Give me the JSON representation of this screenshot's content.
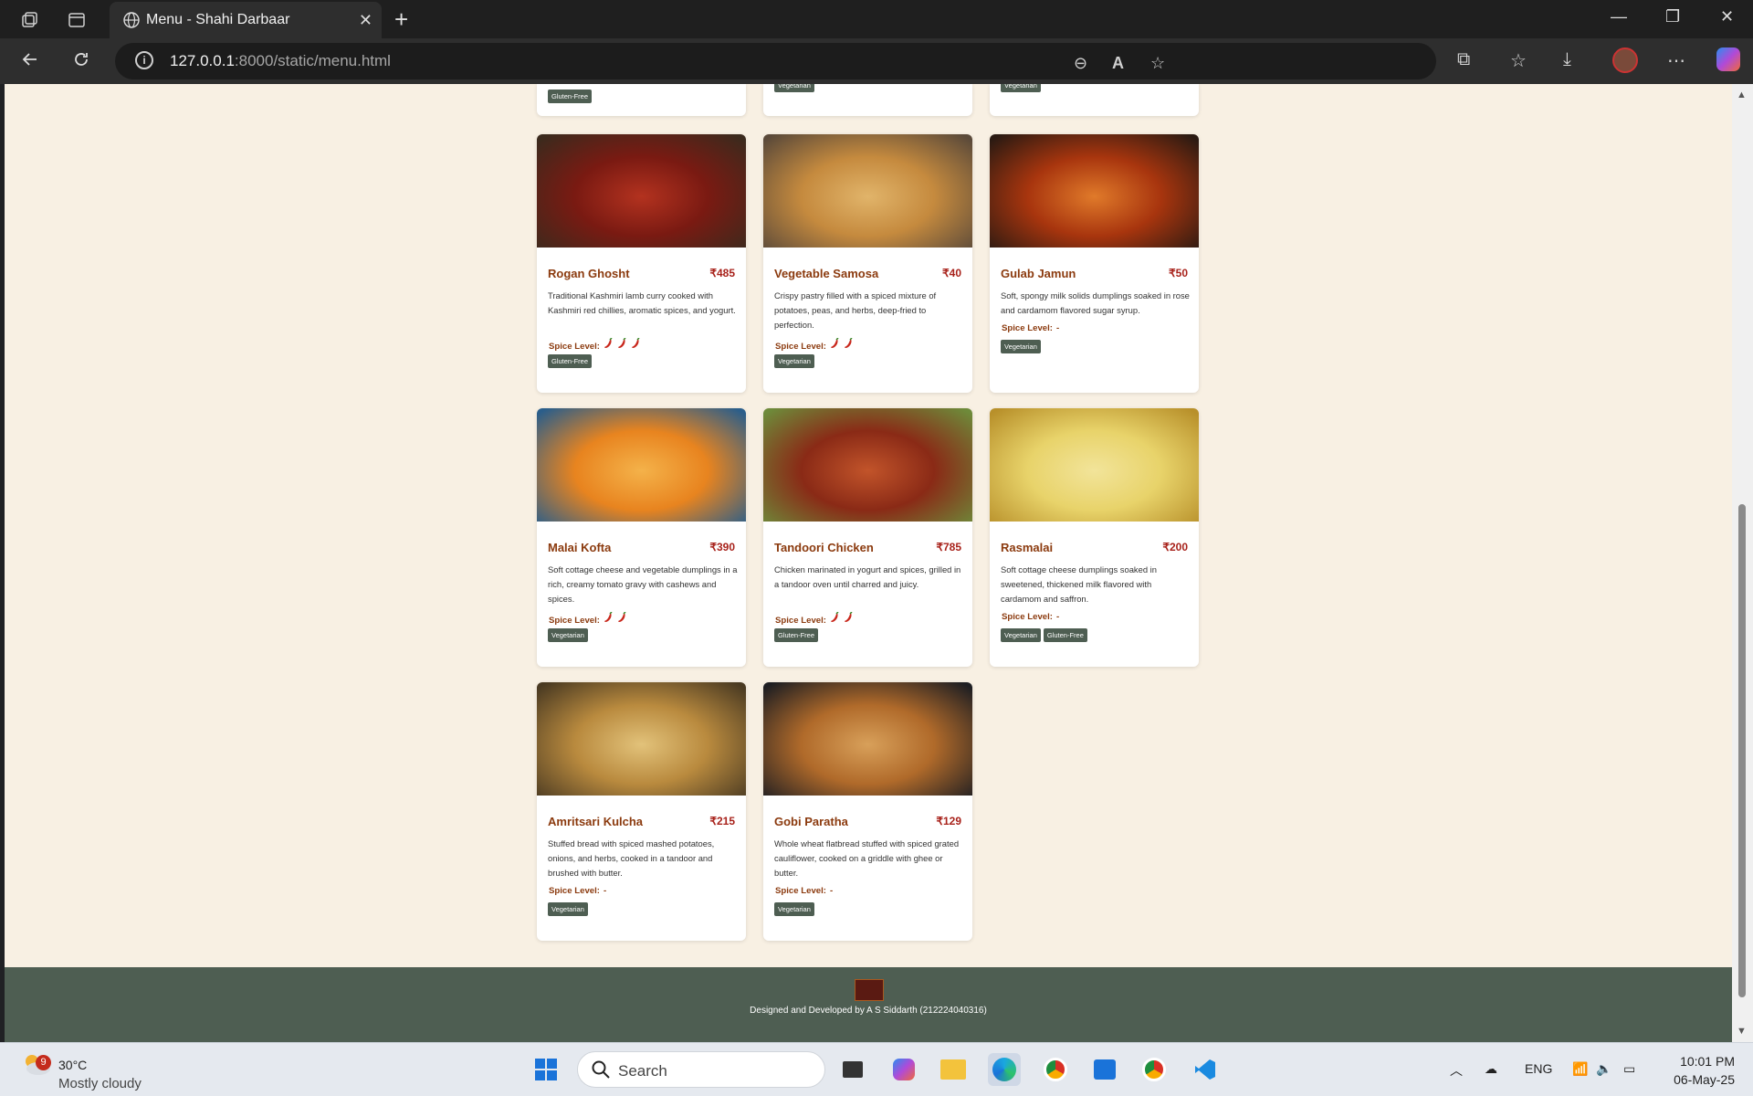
{
  "browser": {
    "tab_title": "Menu - Shahi Darbaar",
    "url_host": "127.0.0.1",
    "url_rest": ":8000/static/menu.html"
  },
  "page": {
    "top_tags": [
      "Gluten-Free",
      "Vegetarian",
      "Vegetarian"
    ],
    "spice_label": "Spice Level:",
    "no_spice": "-",
    "items": [
      {
        "name": "Rogan Ghosht",
        "price": "₹485",
        "desc": "Traditional Kashmiri lamb curry cooked with Kashmiri red chillies, aromatic spices, and yogurt.",
        "spice": 3,
        "tags": [
          "Gluten-Free"
        ],
        "colors": [
          "#7a1a12",
          "#b3321f",
          "#3b2a1d"
        ]
      },
      {
        "name": "Vegetable Samosa",
        "price": "₹40",
        "desc": "Crispy pastry filled with a spiced mixture of potatoes, peas, and herbs, deep-fried to perfection.",
        "spice": 2,
        "tags": [
          "Vegetarian"
        ],
        "colors": [
          "#c58a3e",
          "#e1b46a",
          "#5b4a3a"
        ]
      },
      {
        "name": "Gulab Jamun",
        "price": "₹50",
        "desc": "Soft, spongy milk solids dumplings soaked in rose and cardamom flavored sugar syrup.",
        "spice": 0,
        "tags": [
          "Vegetarian"
        ],
        "colors": [
          "#a8350e",
          "#e07a2a",
          "#2a1a12"
        ]
      },
      {
        "name": "Malai Kofta",
        "price": "₹390",
        "desc": "Soft cottage cheese and vegetable dumplings in a rich, creamy tomato gravy with cashews and spices.",
        "spice": 2,
        "tags": [
          "Vegetarian"
        ],
        "colors": [
          "#e8841f",
          "#f4b24a",
          "#2b5e8a"
        ]
      },
      {
        "name": "Tandoori Chicken",
        "price": "₹785",
        "desc": "Chicken marinated in yogurt and spices, grilled in a tandoor oven until charred and juicy.",
        "spice": 2,
        "tags": [
          "Gluten-Free"
        ],
        "colors": [
          "#8a2a16",
          "#c2542a",
          "#6e8a3a"
        ]
      },
      {
        "name": "Rasmalai",
        "price": "₹200",
        "desc": "Soft cottage cheese dumplings soaked in sweetened, thickened milk flavored with cardamom and saffron.",
        "spice": 0,
        "tags": [
          "Vegetarian",
          "Gluten-Free"
        ],
        "colors": [
          "#e8d36a",
          "#f2e49a",
          "#b8902a"
        ]
      },
      {
        "name": "Amritsari Kulcha",
        "price": "₹215",
        "desc": "Stuffed bread with spiced mashed potatoes, onions, and herbs, cooked in a tandoor and brushed with butter.",
        "spice": 0,
        "tags": [
          "Vegetarian"
        ],
        "colors": [
          "#b98a3e",
          "#e2c27a",
          "#4a3a22"
        ]
      },
      {
        "name": "Gobi Paratha",
        "price": "₹129",
        "desc": "Whole wheat flatbread stuffed with spiced grated cauliflower, cooked on a griddle with ghee or butter.",
        "spice": 0,
        "tags": [
          "Vegetarian"
        ],
        "colors": [
          "#b06a2a",
          "#d8a05a",
          "#1e1e22"
        ]
      }
    ],
    "footer_credit": "Designed and Developed by A S Siddarth (212224040316)"
  },
  "taskbar": {
    "weather_badge": "9",
    "temp": "30°C",
    "condition": "Mostly cloudy",
    "search_label": "Search",
    "lang": "ENG",
    "time": "10:01 PM",
    "date": "06-May-25"
  }
}
